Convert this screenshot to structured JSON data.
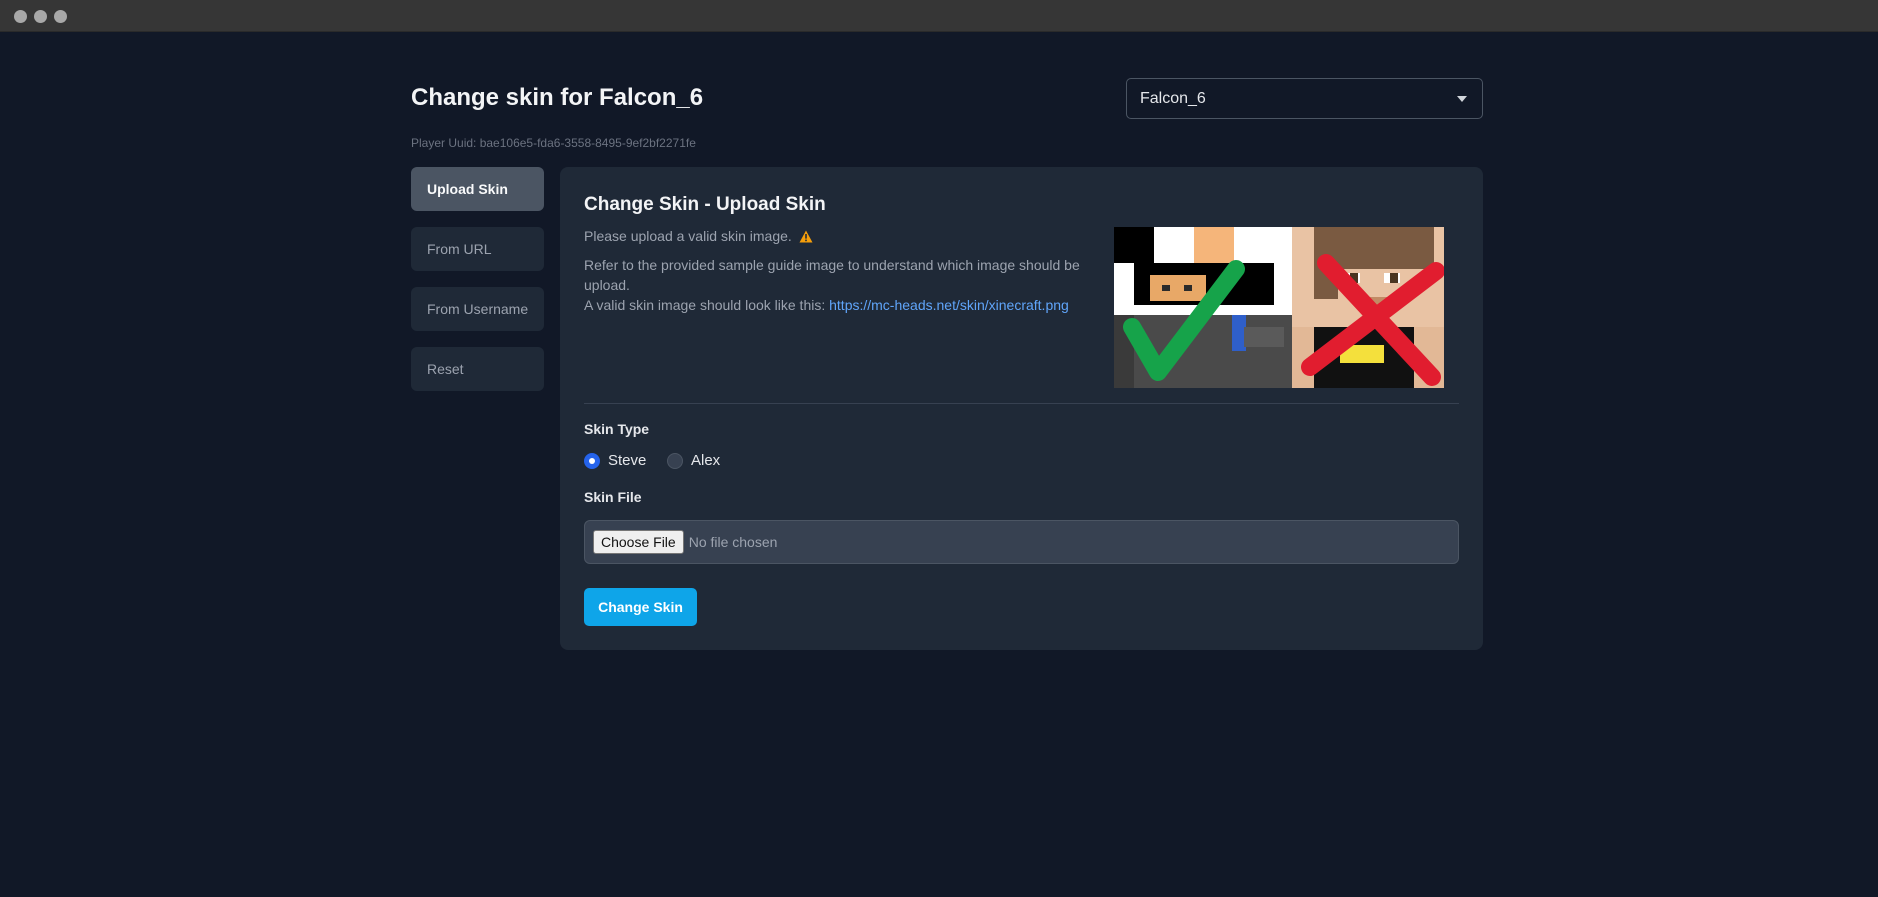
{
  "window": {
    "controls": [
      "close",
      "minimize",
      "maximize"
    ]
  },
  "header": {
    "title": "Change skin for Falcon_6",
    "player_uuid": "Player Uuid: bae106e5-fda6-3558-8495-9ef2bf2271fe"
  },
  "player_select": {
    "value": "Falcon_6",
    "icon": "chevron-down-icon"
  },
  "sidebar": {
    "items": [
      {
        "label": "Upload Skin",
        "active": true
      },
      {
        "label": "From URL",
        "active": false
      },
      {
        "label": "From Username",
        "active": false
      },
      {
        "label": "Reset",
        "active": false
      }
    ]
  },
  "card": {
    "title": "Change Skin - Upload Skin",
    "message": "Please upload a valid skin image.",
    "warning_icon": "warning-icon",
    "guide_line1": "Refer to the provided sample guide image to understand which image should be upload.",
    "guide_line2_prefix": "A valid skin image should look like this:",
    "guide_link": "https://mc-heads.net/skin/xinecraft.png",
    "sample_image": {
      "valid_mark": "checkmark-icon",
      "invalid_mark": "cross-icon"
    },
    "skin_type": {
      "label": "Skin Type",
      "options": [
        {
          "label": "Steve",
          "selected": true
        },
        {
          "label": "Alex",
          "selected": false
        }
      ]
    },
    "skin_file": {
      "label": "Skin File",
      "button_label": "Choose File",
      "status": "No file chosen"
    },
    "submit_label": "Change Skin"
  },
  "colors": {
    "background": "#111827",
    "card": "#1f2937",
    "accent": "#0ea5e9",
    "link": "#60a5fa",
    "radio_selected": "#2563eb",
    "warning": "#f59e0b"
  }
}
